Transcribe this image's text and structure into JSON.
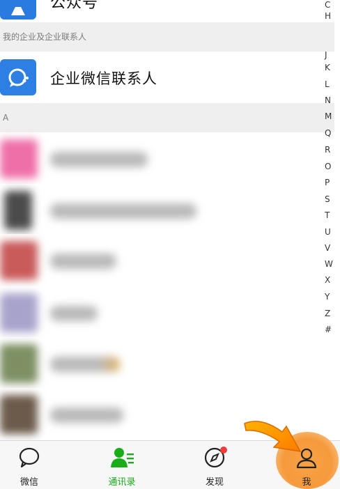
{
  "official_accounts": {
    "label": "公众号",
    "icon": "person-icon",
    "color": "#2a7be0"
  },
  "section_enterprise": {
    "title": "我的企业及企业联系人"
  },
  "wework_contacts": {
    "label": "企业微信联系人",
    "icon": "wework-chat-icon",
    "color": "#2e7fe3"
  },
  "section_a": {
    "title": "A"
  },
  "contacts": [
    {
      "name": "",
      "blurred": true,
      "avatar_color": "#ef6fa8"
    },
    {
      "name": "",
      "blurred": true,
      "avatar_color": "#555555"
    },
    {
      "name": "",
      "blurred": true,
      "avatar_color": "#c95a5a"
    },
    {
      "name": "",
      "blurred": true,
      "avatar_color": "#9b96c0"
    },
    {
      "name": "",
      "blurred": true,
      "avatar_color": "#7d8f63"
    },
    {
      "name": "",
      "blurred": true,
      "avatar_color": "#6c5b4b"
    }
  ],
  "index_letters": [
    "C",
    "H",
    "J",
    "K",
    "L",
    "N",
    "M",
    "Q",
    "R",
    "O",
    "P",
    "S",
    "T",
    "U",
    "V",
    "W",
    "X",
    "Y",
    "Z",
    "#"
  ],
  "tabbar": {
    "tabs": [
      {
        "label": "微信",
        "icon": "chat-bubble-icon",
        "active": false
      },
      {
        "label": "通讯录",
        "icon": "contacts-icon",
        "active": true
      },
      {
        "label": "发现",
        "icon": "compass-icon",
        "active": false,
        "badge": true
      },
      {
        "label": "我",
        "icon": "person-outline-icon",
        "active": false,
        "highlighted": true
      }
    ],
    "active_color": "#1aad19"
  }
}
